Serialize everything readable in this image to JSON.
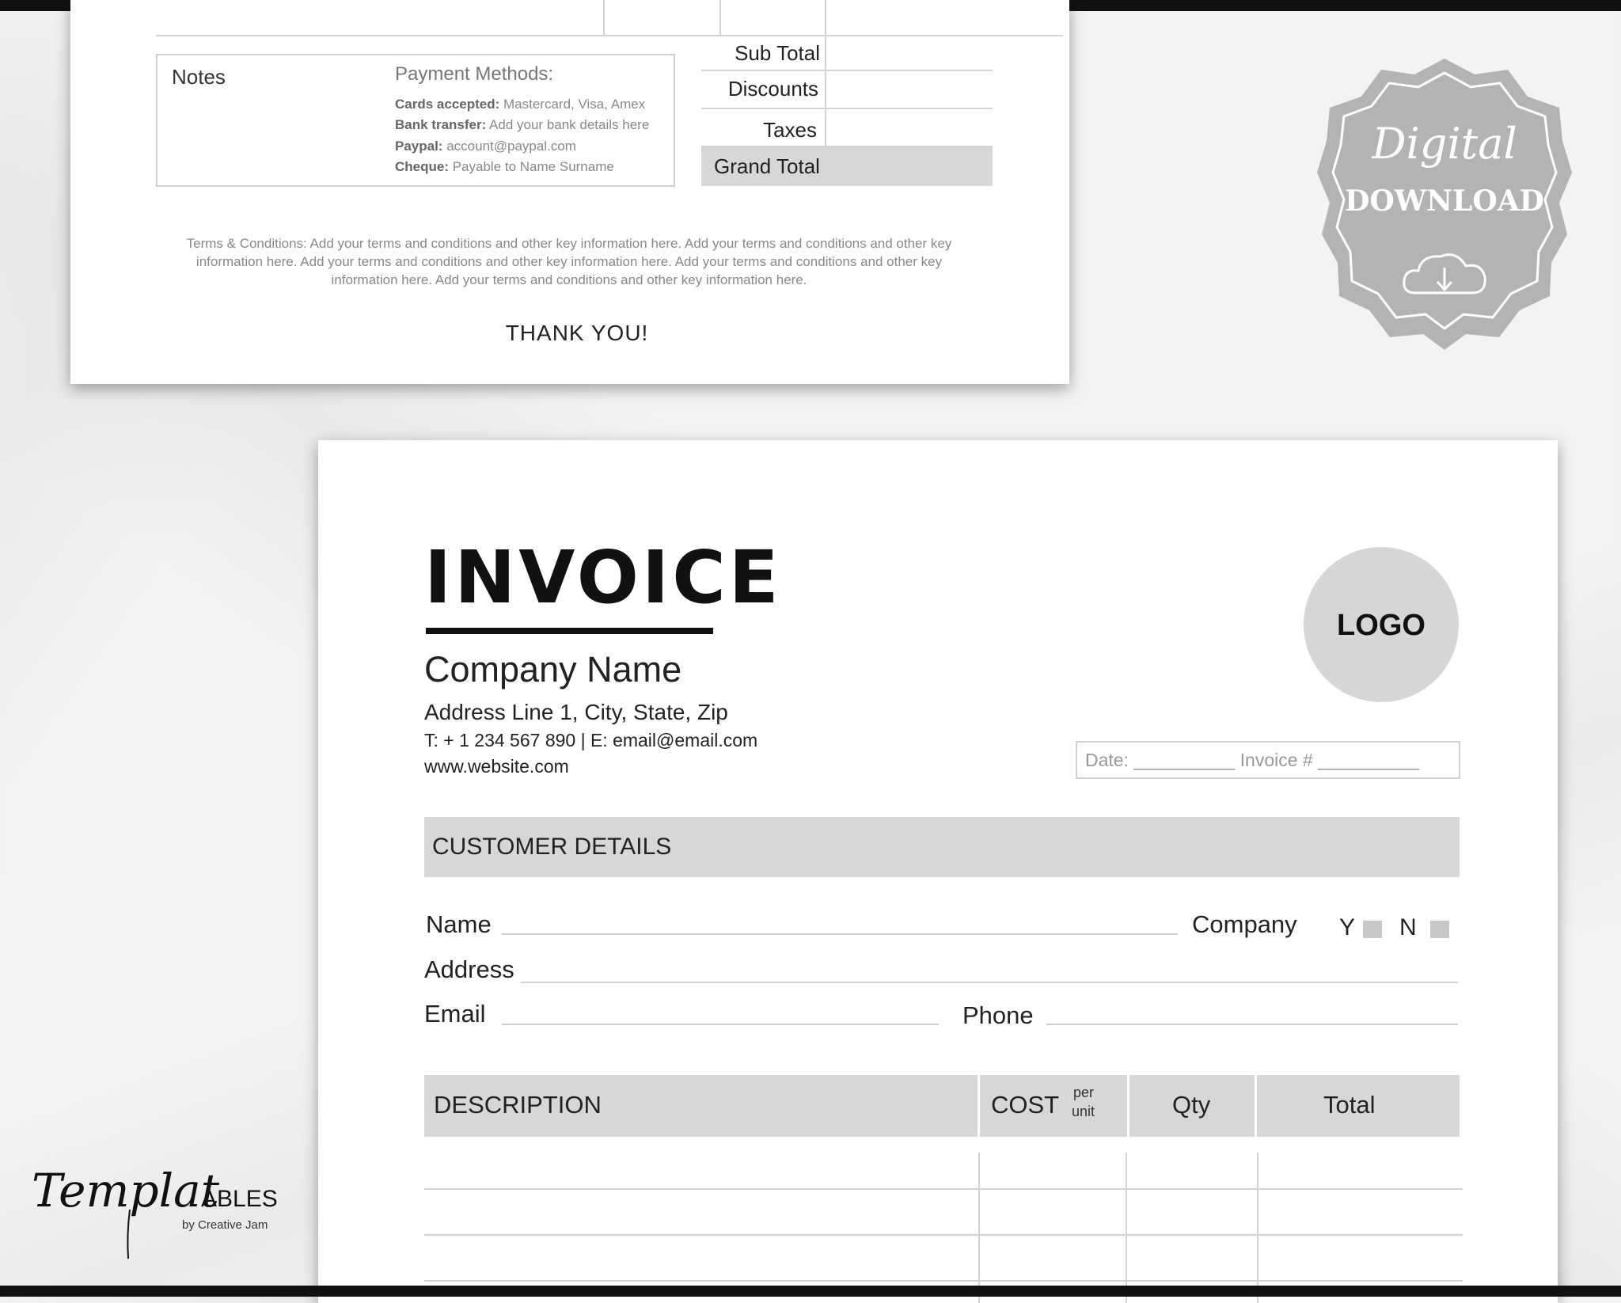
{
  "top_sheet": {
    "notes_label": "Notes",
    "payment_title": "Payment Methods:",
    "payment_lines": [
      {
        "label": "Cards accepted:",
        "value": " Mastercard, Visa, Amex"
      },
      {
        "label": "Bank transfer:",
        "value": "  Add your bank details here"
      },
      {
        "label": "Paypal:",
        "value": " account@paypal.com"
      },
      {
        "label": "Cheque:",
        "value": " Payable to Name Surname"
      }
    ],
    "subtotal_label": "Sub Total",
    "discounts_label": "Discounts",
    "taxes_label": "Taxes",
    "grand_total_label": "Grand Total",
    "terms_line1": "Terms & Conditions: Add your terms and conditions and other key information here. Add your terms and conditions and other key",
    "terms_line2": "information here. Add your terms and conditions and other key information here. Add your terms and conditions and other key",
    "terms_line3": "information here. Add your terms and conditions and other key information here.",
    "thank_you": "THANK YOU!"
  },
  "main_sheet": {
    "title": "INVOICE",
    "company_name": "Company Name",
    "address": "Address Line 1, City, State, Zip",
    "contact": "T: + 1 234 567 890 |  E: email@email.com",
    "website": "www.website.com",
    "logo_text": "LOGO",
    "date_invoice": "Date: __________ Invoice # __________",
    "customer_details_header": "CUSTOMER DETAILS",
    "fields": {
      "name": "Name",
      "company": "Company",
      "yes": "Y",
      "no": "N",
      "address": "Address",
      "email": "Email",
      "phone": "Phone"
    },
    "table_headers": {
      "description": "DESCRIPTION",
      "cost": "COST",
      "per": "per",
      "unit": "unit",
      "qty": "Qty",
      "total": "Total"
    }
  },
  "badge": {
    "script_text": "Digital",
    "text": "DOWNLOAD",
    "icon": "cloud-download-icon",
    "color": "#b3b3b3"
  },
  "brand": {
    "script_text": "Templat",
    "caps_text": "ABLES",
    "byline": "by Creative Jam"
  }
}
